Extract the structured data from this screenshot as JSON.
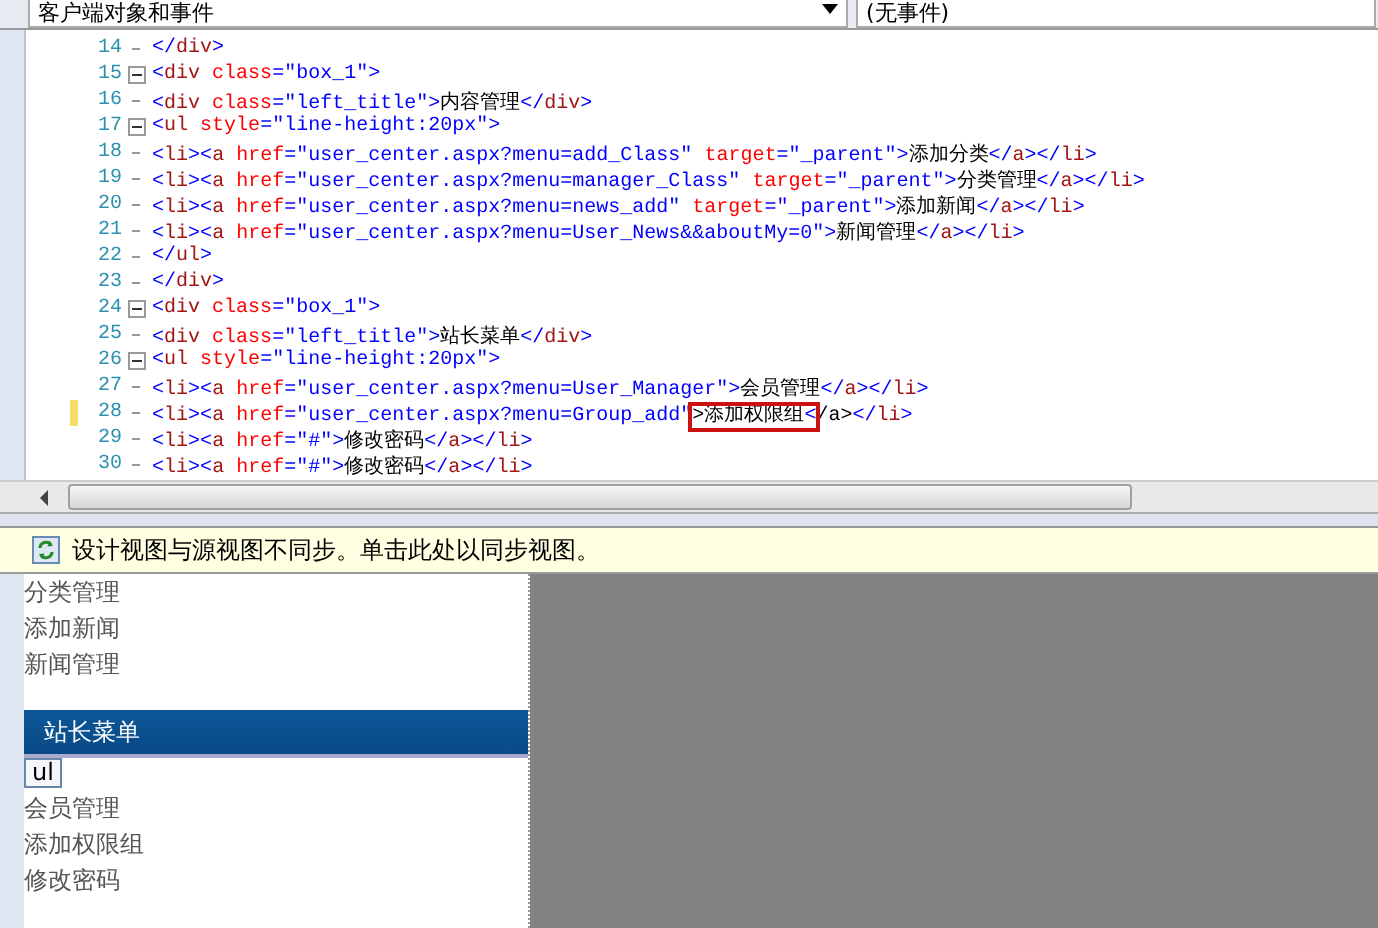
{
  "toolbar": {
    "object_dropdown": "客户端对象和事件",
    "event_dropdown": "(无事件)"
  },
  "code_lines": [
    {
      "number": "14",
      "kind": "line",
      "text": "</div>"
    },
    {
      "number": "15",
      "kind": "fold",
      "text": "<div class=\"box_1\">"
    },
    {
      "number": "16",
      "kind": "line",
      "text": "<div class=\"left_title\">内容管理</div>"
    },
    {
      "number": "17",
      "kind": "fold",
      "text": "<ul style=\"line-height:20px\">"
    },
    {
      "number": "18",
      "kind": "line",
      "text": "<li><a href=\"user_center.aspx?menu=add_Class\" target=\"_parent\">添加分类</a></li>"
    },
    {
      "number": "19",
      "kind": "line",
      "text": "<li><a href=\"user_center.aspx?menu=manager_Class\" target=\"_parent\">分类管理</a></li>"
    },
    {
      "number": "20",
      "kind": "line",
      "text": "<li><a href=\"user_center.aspx?menu=news_add\" target=\"_parent\">添加新闻</a></li>"
    },
    {
      "number": "21",
      "kind": "line",
      "text": "<li><a href=\"user_center.aspx?menu=User_News&&aboutMy=0\">新闻管理</a></li>"
    },
    {
      "number": "22",
      "kind": "line",
      "text": "</ul>"
    },
    {
      "number": "23",
      "kind": "line",
      "text": "</div>"
    },
    {
      "number": "24",
      "kind": "fold",
      "text": "<div class=\"box_1\">"
    },
    {
      "number": "25",
      "kind": "line",
      "text": "<div class=\"left_title\">站长菜单</div>"
    },
    {
      "number": "26",
      "kind": "fold",
      "text": "<ul style=\"line-height:20px\">"
    },
    {
      "number": "27",
      "kind": "line",
      "text": "<li><a href=\"user_center.aspx?menu=User_Manager\">会员管理</a></li>"
    },
    {
      "number": "28",
      "kind": "line",
      "modified": true,
      "text": "<li><a href=\"user_center.aspx?menu=Group_add\"",
      "boxed": ">添加权限组<",
      "after": "/a></li>"
    },
    {
      "number": "29",
      "kind": "line",
      "text": "<li><a href=\"#\">修改密码</a></li>"
    },
    {
      "number": "30",
      "kind": "line",
      "text": "<li><a href=\"#\">修改密码</a></li>"
    }
  ],
  "sync_banner": "设计视图与源视图不同步。单击此处以同步视图。",
  "design_view": {
    "items": [
      {
        "kind": "link",
        "text": "分类管理"
      },
      {
        "kind": "link",
        "text": "添加新闻"
      },
      {
        "kind": "link",
        "text": "新闻管理"
      },
      {
        "kind": "spacer"
      },
      {
        "kind": "title",
        "text": "站长菜单",
        "selected": true
      },
      {
        "kind": "tag",
        "text": "ul"
      },
      {
        "kind": "link",
        "text": "会员管理"
      },
      {
        "kind": "link",
        "text": "添加权限组"
      },
      {
        "kind": "link",
        "text": "修改密码"
      }
    ]
  }
}
